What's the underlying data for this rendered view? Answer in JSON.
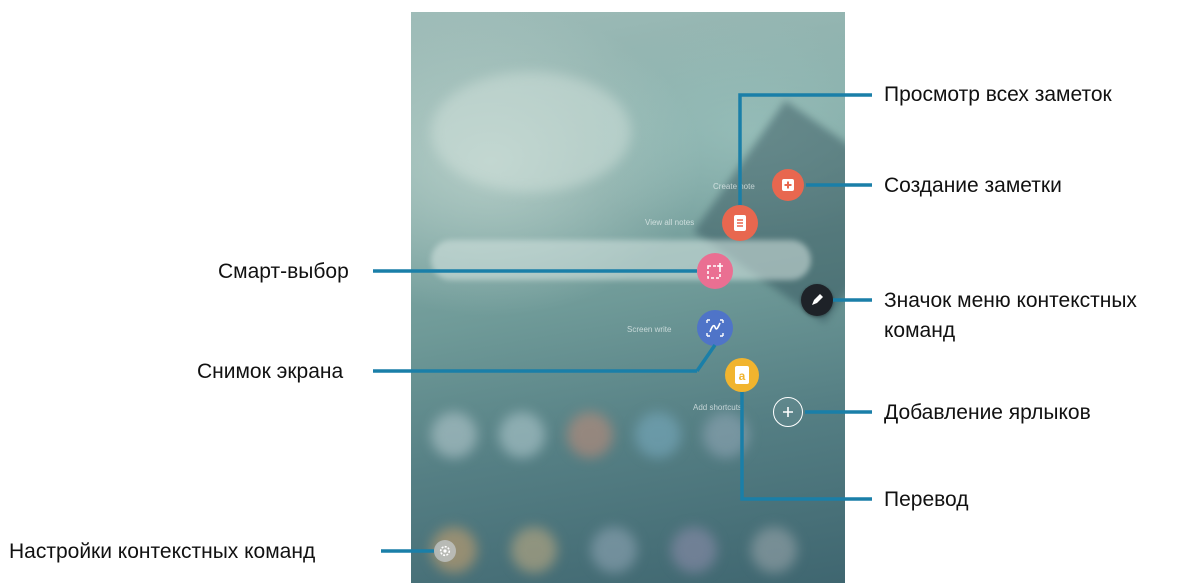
{
  "labels": {
    "view_all_notes": "Просмотр всех заметок",
    "create_note": "Создание заметки",
    "smart_select": "Смарт-выбор",
    "command_icon_line1": "Значок меню контекстных",
    "command_icon_line2": "команд",
    "screen_write": "Снимок экрана",
    "add_shortcuts": "Добавление ярлыков",
    "translate": "Перевод",
    "command_settings": "Настройки контекстных команд"
  },
  "screen_labels": {
    "create_note": "Create note",
    "view_all_notes": "View all notes",
    "screen_write": "Screen write",
    "add_shortcuts": "Add shortcuts"
  },
  "icons": {
    "create_note": "note-add-icon",
    "view_all_notes": "notes-list-icon",
    "smart_select": "smart-select-icon",
    "screen_write": "screen-write-icon",
    "translate": "translate-icon",
    "command_button": "pen-icon",
    "add_shortcuts": "plus-icon",
    "settings": "gear-icon"
  },
  "colors": {
    "red": "#e8674f",
    "pink": "#ea6f92",
    "blue": "#4f74c8",
    "yellow": "#f1b42e",
    "leader_lines": "#1a7fa8"
  }
}
